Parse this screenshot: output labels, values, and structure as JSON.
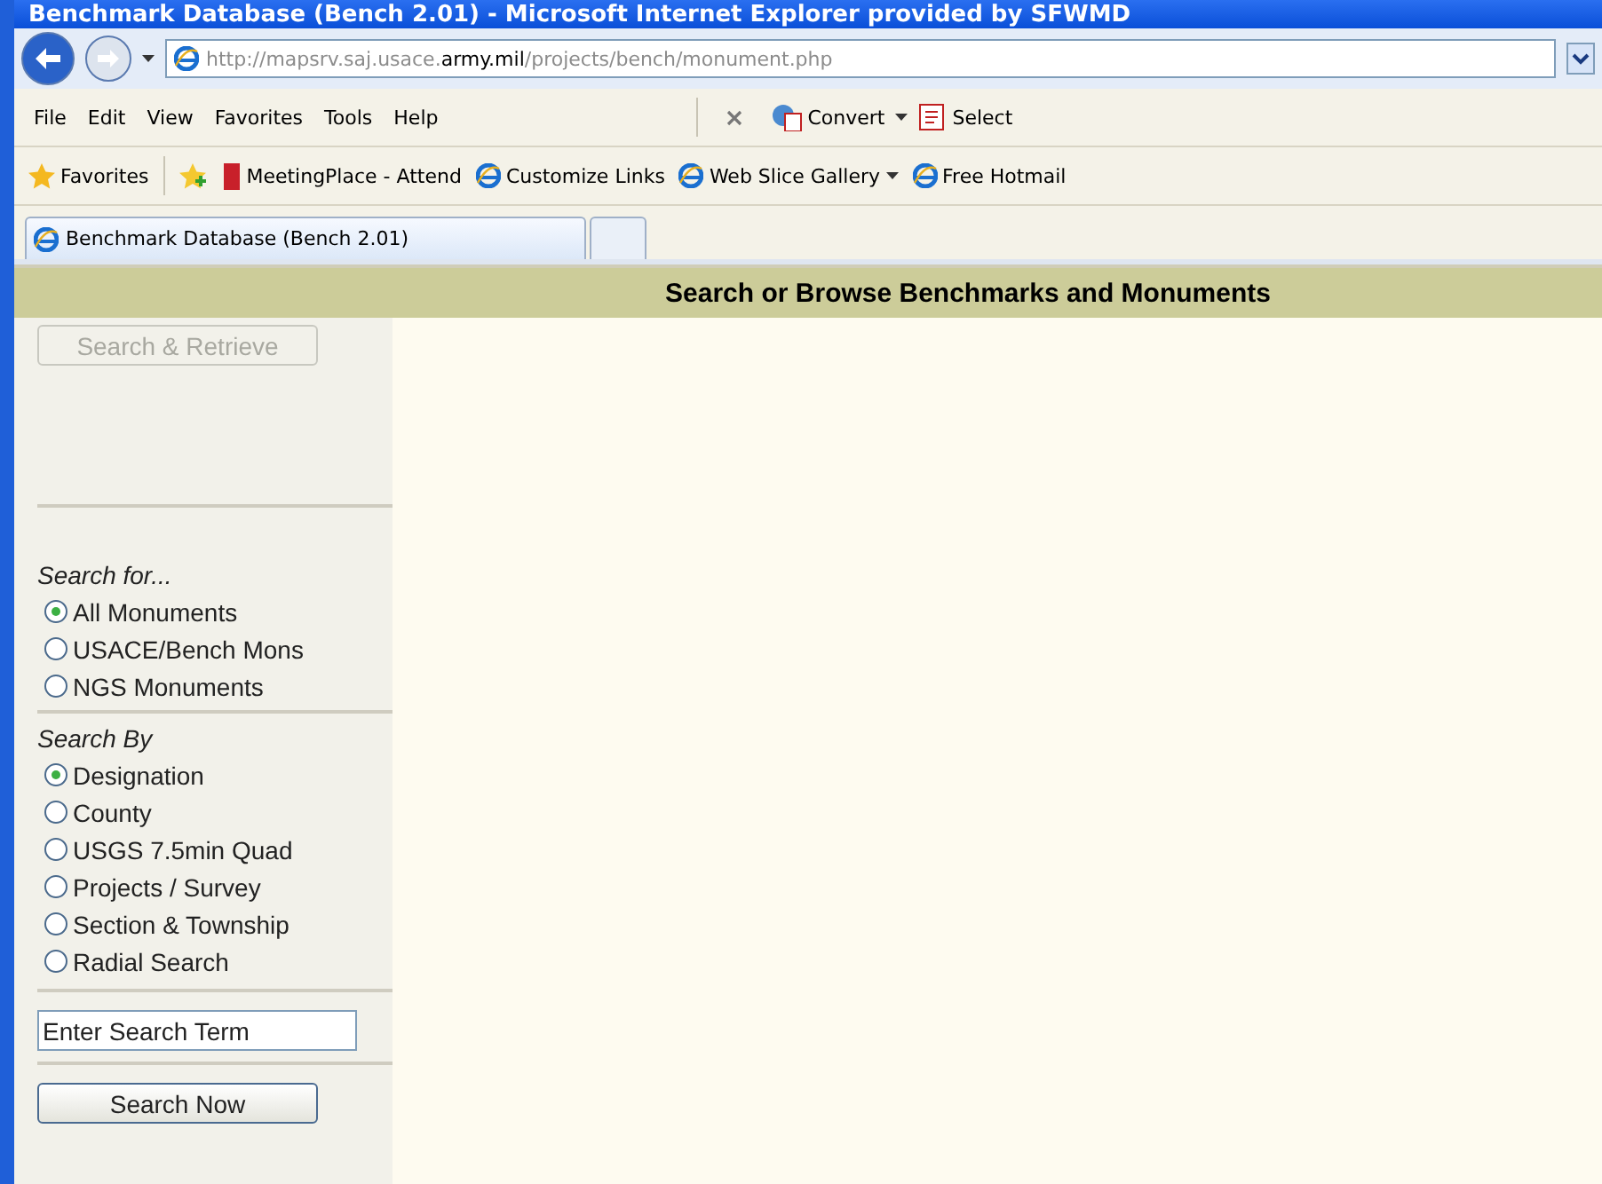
{
  "window": {
    "title": "Benchmark Database (Bench 2.01) - Microsoft Internet Explorer provided by SFWMD"
  },
  "address": {
    "url_prefix": "http://mapsrv.saj.usace.",
    "url_domain": "army.mil",
    "url_path": "/projects/bench/monument.php"
  },
  "menu": [
    "File",
    "Edit",
    "View",
    "Favorites",
    "Tools",
    "Help"
  ],
  "toolbar": [
    {
      "label": "Convert",
      "kind": "convert"
    },
    {
      "label": "Select",
      "kind": "select"
    }
  ],
  "favorites_bar": {
    "label": "Favorites",
    "links": [
      {
        "label": "MeetingPlace - Attend",
        "kind": "book",
        "dropdown": false
      },
      {
        "label": "Customize Links",
        "kind": "ie",
        "dropdown": false
      },
      {
        "label": "Web Slice Gallery",
        "kind": "ie",
        "dropdown": true
      },
      {
        "label": "Free Hotmail",
        "kind": "ie",
        "dropdown": false
      }
    ]
  },
  "tabs": [
    {
      "label": "Benchmark Database (Bench 2.01)",
      "selected": true
    }
  ],
  "page": {
    "header": "Search or Browse Benchmarks and Monuments",
    "retrieve_button": {
      "label": "Search & Retrieve",
      "disabled": true
    },
    "groups": [
      {
        "title": "Search for...",
        "options": [
          {
            "label": "All Monuments",
            "selected": true
          },
          {
            "label": "USACE/Bench Mons",
            "selected": false
          },
          {
            "label": "NGS Monuments",
            "selected": false
          }
        ]
      },
      {
        "title": "Search By",
        "options": [
          {
            "label": "Designation",
            "selected": true
          },
          {
            "label": "County",
            "selected": false
          },
          {
            "label": "USGS 7.5min Quad",
            "selected": false
          },
          {
            "label": "Projects / Survey",
            "selected": false
          },
          {
            "label": "Section & Township",
            "selected": false
          },
          {
            "label": "Radial Search",
            "selected": false
          }
        ]
      }
    ],
    "search_field": {
      "value": "Enter Search Term"
    },
    "search_button": {
      "label": "Search Now",
      "disabled": false
    }
  }
}
